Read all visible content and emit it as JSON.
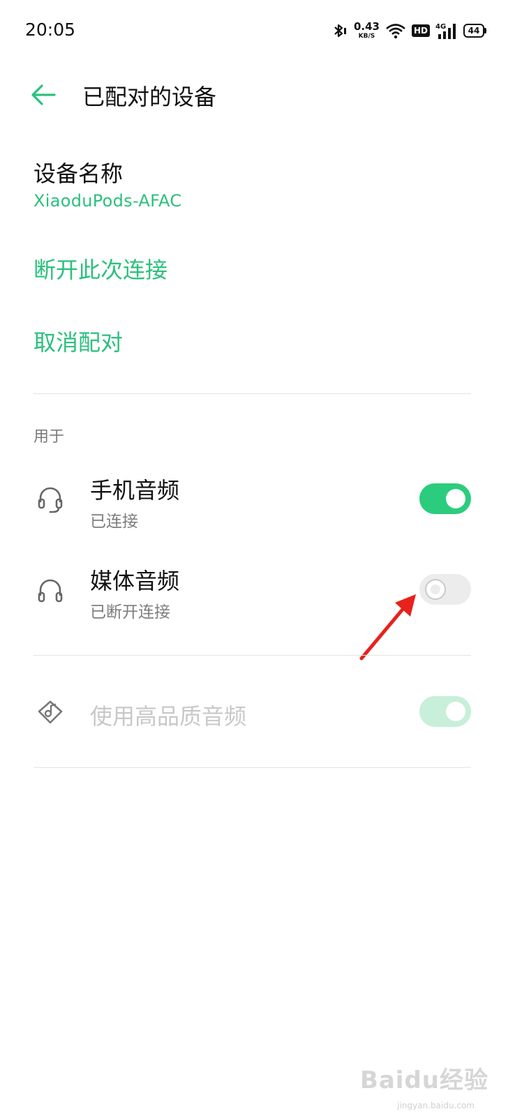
{
  "status_bar": {
    "time": "20:05",
    "net_speed": "0.43",
    "net_unit": "KB/S",
    "hd": "HD",
    "signal_tech": "4G",
    "battery": "44",
    "icons": [
      "bluetooth-icon",
      "wifi-icon",
      "hd-icon",
      "signal-icon",
      "battery-icon"
    ]
  },
  "header": {
    "back_icon": "back-arrow-icon",
    "title": "已配对的设备"
  },
  "device": {
    "label": "设备名称",
    "name": "XiaoduPods-AFAC"
  },
  "actions": {
    "disconnect": "断开此次连接",
    "unpair": "取消配对"
  },
  "profiles": {
    "section_label": "用于",
    "items": [
      {
        "icon": "headset-icon",
        "title": "手机音频",
        "subtitle": "已连接",
        "enabled": true
      },
      {
        "icon": "headphones-icon",
        "title": "媒体音频",
        "subtitle": "已断开连接",
        "enabled": false
      }
    ]
  },
  "hq_audio": {
    "icon": "hq-audio-icon",
    "title": "使用高品质音频",
    "enabled": true,
    "disabled_state": true
  },
  "annotation": {
    "arrow_color": "#e8211c"
  },
  "watermark": {
    "text": "Baidu经验",
    "url": "jingyan.baidu.com"
  },
  "colors": {
    "accent": "#2bc07d",
    "toggle_on": "#2bcc7e",
    "toggle_off": "#ececec"
  }
}
